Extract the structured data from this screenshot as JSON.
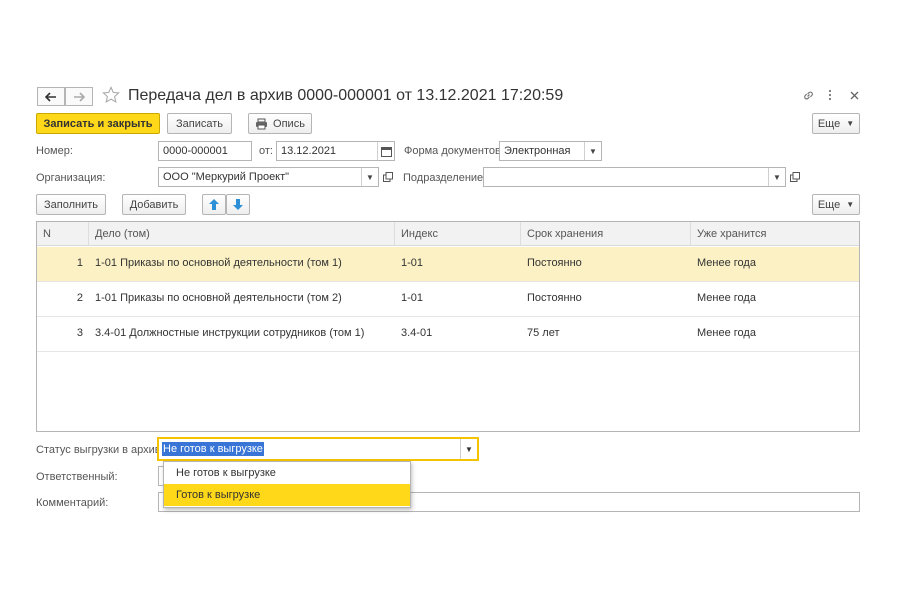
{
  "window": {
    "title": "Передача дел в архив 0000-000001 от 13.12.2021 17:20:59"
  },
  "toolbar": {
    "save_close_label": "Записать и закрыть",
    "save_label": "Записать",
    "print_label": "Опись",
    "more_label": "Еще"
  },
  "form": {
    "number_label": "Номер:",
    "number_value": "0000-000001",
    "date_label": "от:",
    "date_value": "13.12.2021",
    "doc_form_label": "Форма документов:",
    "doc_form_value": "Электронная",
    "org_label": "Организация:",
    "org_value": "ООО \"Меркурий Проект\"",
    "dept_label": "Подразделение:",
    "dept_value": ""
  },
  "table_toolbar": {
    "fill_label": "Заполнить",
    "add_label": "Добавить",
    "more_label": "Еще"
  },
  "table": {
    "columns": [
      "N",
      "Дело (том)",
      "Индекс",
      "Срок хранения",
      "Уже хранится"
    ],
    "rows": [
      {
        "n": "1",
        "case": "1-01 Приказы по основной деятельности (том 1)",
        "index": "1-01",
        "term": "Постоянно",
        "stored": "Менее года"
      },
      {
        "n": "2",
        "case": "1-01 Приказы по основной деятельности (том 2)",
        "index": "1-01",
        "term": "Постоянно",
        "stored": "Менее года"
      },
      {
        "n": "3",
        "case": "3.4-01 Должностные инструкции сотрудников (том 1)",
        "index": "3.4-01",
        "term": "75 лет",
        "stored": "Менее года"
      }
    ]
  },
  "footer": {
    "status_label": "Статус выгрузки в архив:",
    "status_value": "Не готов к выгрузке",
    "status_options": [
      "Не готов к выгрузке",
      "Готов к выгрузке"
    ],
    "responsible_label": "Ответственный:",
    "responsible_value": "",
    "comment_label": "Комментарий:",
    "comment_value": ""
  },
  "colors": {
    "accent_yellow": "#ffd819",
    "selected_row": "#fbf1c4",
    "selection_blue": "#3875d7",
    "arrow_blue": "#2d8fd5"
  }
}
